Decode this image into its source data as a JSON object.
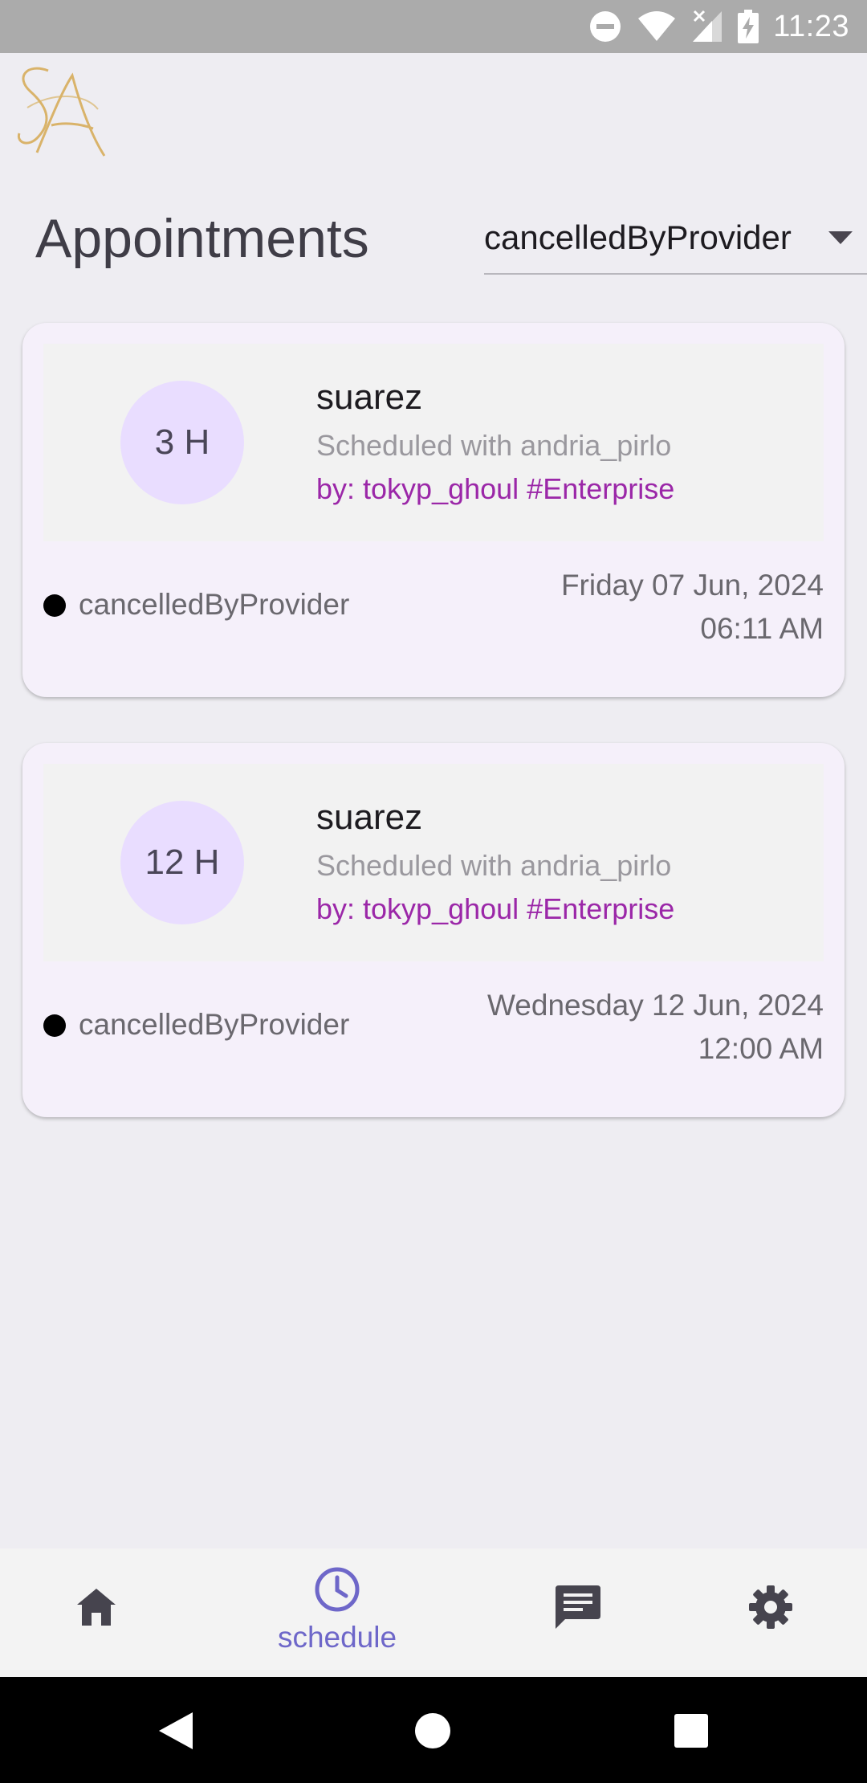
{
  "status_bar": {
    "time": "11:23",
    "icons": [
      "dnd-icon",
      "wifi-icon",
      "no-signal-icon",
      "battery-charging-icon"
    ]
  },
  "header": {
    "logo_text": "SA",
    "title": "Appointments",
    "filter": {
      "selected": "cancelledByProvider",
      "icon": "dropdown-arrow-icon"
    }
  },
  "appointments": [
    {
      "duration": "3 H",
      "client": "suarez",
      "scheduled_with": "Scheduled with andria_pirlo",
      "booked_by": "by: tokyp_ghoul #Enterprise",
      "status": "cancelledByProvider",
      "date": "Friday 07 Jun, 2024",
      "time": "06:11 AM"
    },
    {
      "duration": "12 H",
      "client": "suarez",
      "scheduled_with": "Scheduled with andria_pirlo",
      "booked_by": "by: tokyp_ghoul #Enterprise",
      "status": "cancelledByProvider",
      "date": "Wednesday 12 Jun, 2024",
      "time": "12:00 AM"
    }
  ],
  "bottom_nav": {
    "items": [
      {
        "icon": "home-icon",
        "label": ""
      },
      {
        "icon": "clock-icon",
        "label": "schedule",
        "active": true
      },
      {
        "icon": "chat-icon",
        "label": ""
      },
      {
        "icon": "gear-icon",
        "label": ""
      }
    ]
  },
  "colors": {
    "accent": "#6e67c9",
    "booked_by": "#9b27a8",
    "badge_bg": "#e9ddff",
    "card_bg": "#f5f0fa",
    "page_bg": "#eeedf2",
    "logo_gold": "#d9b36a"
  }
}
